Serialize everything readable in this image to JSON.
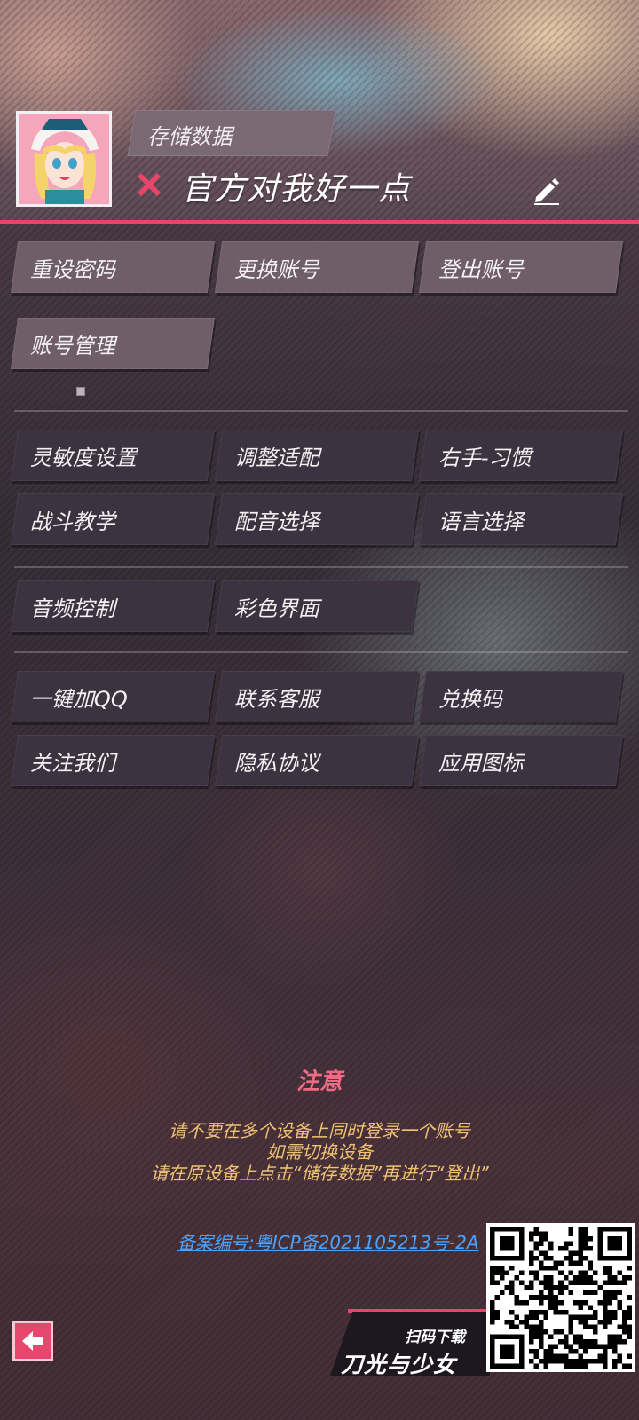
{
  "header": {
    "save_data_label": "存储数据",
    "username": "官方对我好一点",
    "status_icon": "x-icon",
    "edit_icon": "pencil-icon",
    "avatar_icon": "avatar-character-icon"
  },
  "account_section": {
    "buttons": [
      {
        "label": "重设密码"
      },
      {
        "label": "更换账号"
      },
      {
        "label": "登出账号"
      },
      {
        "label": "账号管理"
      }
    ]
  },
  "settings_section": {
    "buttons": [
      {
        "label": "灵敏度设置"
      },
      {
        "label": "调整适配"
      },
      {
        "label": "右手-习惯"
      },
      {
        "label": "战斗教学"
      },
      {
        "label": "配音选择"
      },
      {
        "label": "语言选择"
      }
    ]
  },
  "media_section": {
    "buttons": [
      {
        "label": "音频控制"
      },
      {
        "label": "彩色界面"
      }
    ]
  },
  "social_section": {
    "buttons": [
      {
        "label": "一键加QQ"
      },
      {
        "label": "联系客服"
      },
      {
        "label": "兑换码"
      },
      {
        "label": "关注我们"
      },
      {
        "label": "隐私协议"
      },
      {
        "label": "应用图标"
      }
    ]
  },
  "notice": {
    "title": "注意",
    "lines": [
      "请不要在多个设备上同时登录一个账号",
      "如需切换设备",
      "请在原设备上点击“储存数据”再进行“登出”"
    ]
  },
  "icp": "备案编号:粤ICP备2021105213号-2A",
  "download": {
    "scan_label": "扫码下载",
    "game_name": "刀光与少女",
    "qr_icon": "qr-code-icon"
  },
  "back_icon": "back-arrow-icon",
  "colors": {
    "accent": "#e8456b",
    "notice_title": "#f06a86",
    "notice_text": "#f0c274",
    "link": "#4aa3ff",
    "button_light": "#6f5e68",
    "button_dark": "#3c3240"
  }
}
